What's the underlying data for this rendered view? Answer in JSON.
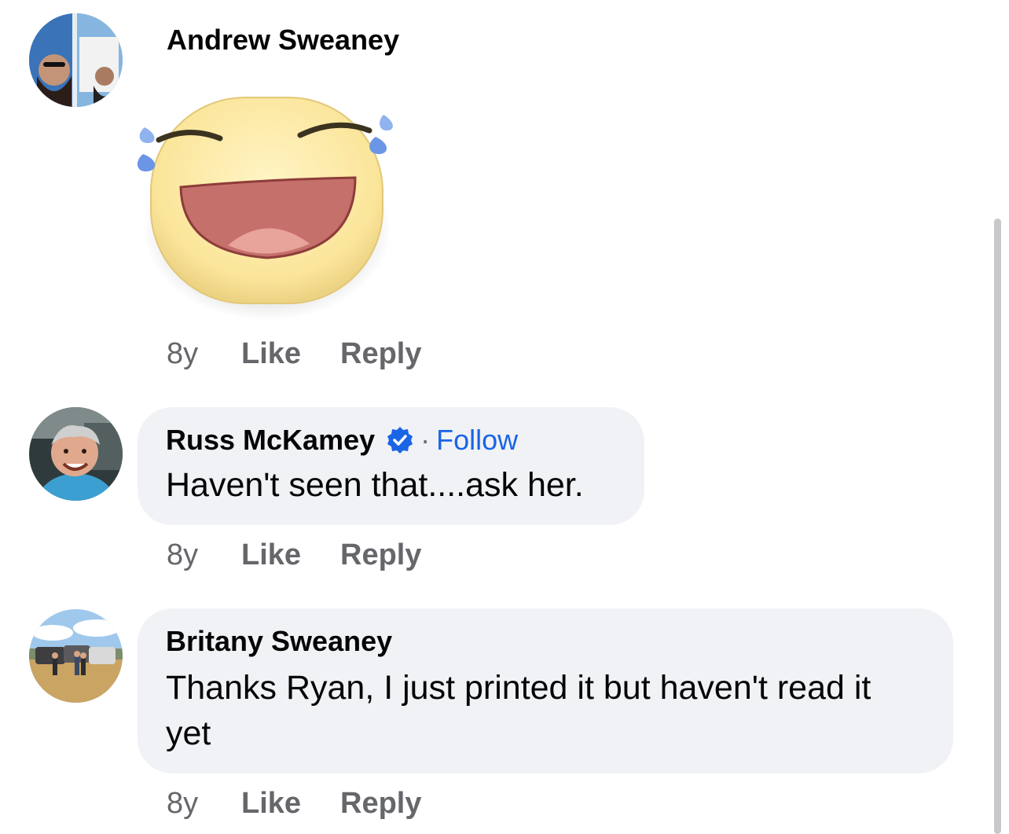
{
  "comments": [
    {
      "author": "Andrew Sweaney",
      "sticker": "laughing-tears-sticker",
      "age": "8y",
      "like_label": "Like",
      "reply_label": "Reply"
    },
    {
      "author": "Russ McKamey",
      "verified": true,
      "separator": "·",
      "follow_label": "Follow",
      "text": "Haven't seen that....ask her.",
      "age": "8y",
      "like_label": "Like",
      "reply_label": "Reply"
    },
    {
      "author": "Britany Sweaney",
      "text": "Thanks Ryan, I just printed it but haven't read it yet",
      "age": "8y",
      "like_label": "Like",
      "reply_label": "Reply"
    }
  ],
  "colors": {
    "accent_blue": "#1b64e6",
    "bubble_bg": "#f0f2f5",
    "meta_gray": "#65676b"
  }
}
